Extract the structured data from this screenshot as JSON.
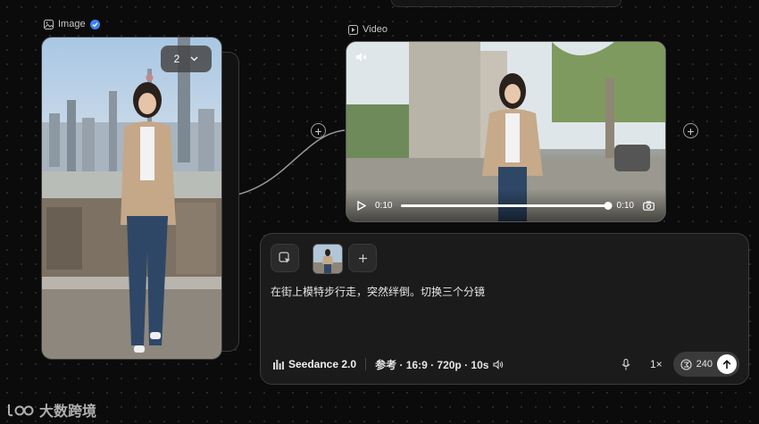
{
  "image_node": {
    "label": "Image",
    "icon": "image-icon",
    "badge_icon": "verified-check-icon",
    "count_value": "2"
  },
  "video_node": {
    "label": "Video",
    "icon": "video-icon",
    "current_time": "0:10",
    "duration": "0:10",
    "progress": 1.0
  },
  "prompt": {
    "text": "在街上模特步行走，突然绊倒。切换三个分镜",
    "model_name": "Seedance 2.0",
    "settings": "参考 · 16:9 · 720p · 10s",
    "speed": "1×",
    "credits": "240"
  },
  "watermark": {
    "text": "大数跨境"
  },
  "colors": {
    "accent_verified": "#3b82f6",
    "panel_bg": "#1b1b1b",
    "canvas_bg": "#0b0b0b"
  }
}
